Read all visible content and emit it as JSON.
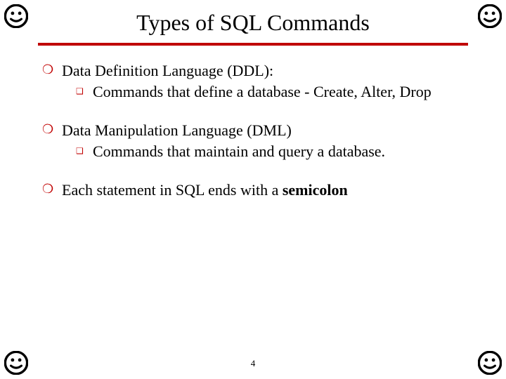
{
  "title": "Types of SQL Commands",
  "items": [
    {
      "head": "Data Definition Language (DDL):",
      "sub": "Commands that define a database - Create, Alter, Drop"
    },
    {
      "head": "Data Manipulation Language (DML)",
      "sub": "Commands that maintain and query a database."
    },
    {
      "plain_before": "Each statement in SQL ends with a ",
      "plain_bold": "semicolon"
    }
  ],
  "page_number": "4",
  "glyphs": {
    "bullet_m": "❍",
    "bullet_q": "❑"
  }
}
